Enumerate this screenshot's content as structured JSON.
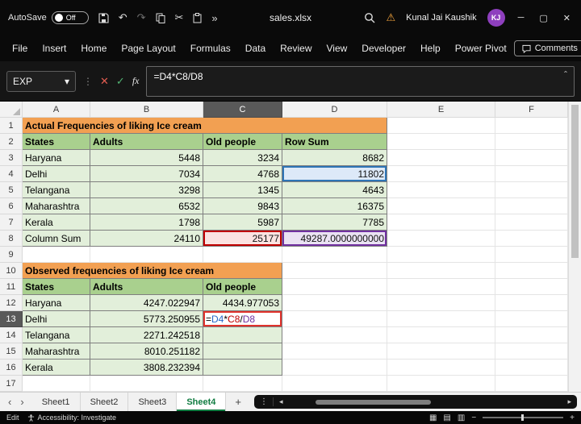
{
  "colors": {
    "excel_green": "#107C41",
    "title_orange": "#F2A052",
    "header_green": "#A9D08E",
    "cell_green": "#E2EFDA",
    "ref_blue": "#2E75B6",
    "ref_red": "#C00000",
    "ref_purple": "#7030A0",
    "avatar_purple": "#8E3FBE"
  },
  "icons": {
    "undo": "↶",
    "redo": "↷",
    "cut": "✂",
    "more_chevrons": "»",
    "minimize": "─",
    "maximize": "▢",
    "close": "✕",
    "name_box_dropdown": "▾",
    "separator_dots": "⋮",
    "cancel": "✕",
    "enter": "✓",
    "collapse_formula_bar": "ˆ",
    "warning": "⚠",
    "share_dropdown": "▾",
    "tab_scroll_left": "‹",
    "tab_scroll_right": "›",
    "overflow_dots": "⋮",
    "hscroll_left": "◂",
    "hscroll_right": "▸",
    "view_normal": "▦",
    "view_page": "▤",
    "view_break": "▥",
    "zoom_out": "−",
    "zoom_in": "+"
  },
  "titlebar": {
    "autosave_label": "AutoSave",
    "autosave_state": "Off",
    "filename": "sales.xlsx",
    "user_name": "Kunal Jai Kaushik",
    "user_initials": "KJ"
  },
  "menubar": {
    "items": [
      "File",
      "Insert",
      "Home",
      "Page Layout",
      "Formulas",
      "Data",
      "Review",
      "View",
      "Developer",
      "Help",
      "Power Pivot"
    ],
    "comments_label": "Comments"
  },
  "formula_bar": {
    "name_box_value": "EXP",
    "fx_label": "fx",
    "formula_text": "=D4*C8/D8"
  },
  "grid": {
    "col_headers": [
      "A",
      "B",
      "C",
      "D",
      "E",
      "F"
    ],
    "selected_col": "C",
    "selected_row": 13,
    "rows": [
      {
        "n": 1,
        "cells": [
          {
            "col": "A",
            "span": 4,
            "style": "title",
            "text": "Actual Frequencies of liking Ice cream"
          }
        ]
      },
      {
        "n": 2,
        "cells": [
          {
            "col": "A",
            "style": "header",
            "text": "States"
          },
          {
            "col": "B",
            "style": "header",
            "text": "Adults"
          },
          {
            "col": "C",
            "style": "header",
            "text": "Old people"
          },
          {
            "col": "D",
            "style": "header",
            "text": "Row Sum"
          }
        ]
      },
      {
        "n": 3,
        "cells": [
          {
            "col": "A",
            "style": "data",
            "text": "Haryana"
          },
          {
            "col": "B",
            "style": "data num",
            "text": "5448"
          },
          {
            "col": "C",
            "style": "data num",
            "text": "3234"
          },
          {
            "col": "D",
            "style": "data num",
            "text": "8682"
          }
        ]
      },
      {
        "n": 4,
        "cells": [
          {
            "col": "A",
            "style": "data",
            "text": "Delhi"
          },
          {
            "col": "B",
            "style": "data num",
            "text": "7034"
          },
          {
            "col": "C",
            "style": "data num",
            "text": "4768"
          },
          {
            "col": "D",
            "style": "refblue num",
            "text": "11802"
          }
        ]
      },
      {
        "n": 5,
        "cells": [
          {
            "col": "A",
            "style": "data",
            "text": "Telangana"
          },
          {
            "col": "B",
            "style": "data num",
            "text": "3298"
          },
          {
            "col": "C",
            "style": "data num",
            "text": "1345"
          },
          {
            "col": "D",
            "style": "data num",
            "text": "4643"
          }
        ]
      },
      {
        "n": 6,
        "cells": [
          {
            "col": "A",
            "style": "data",
            "text": "Maharashtra"
          },
          {
            "col": "B",
            "style": "data num",
            "text": "6532"
          },
          {
            "col": "C",
            "style": "data num",
            "text": "9843"
          },
          {
            "col": "D",
            "style": "data num",
            "text": "16375"
          }
        ]
      },
      {
        "n": 7,
        "cells": [
          {
            "col": "A",
            "style": "data",
            "text": "Kerala"
          },
          {
            "col": "B",
            "style": "data num",
            "text": "1798"
          },
          {
            "col": "C",
            "style": "data num",
            "text": "5987"
          },
          {
            "col": "D",
            "style": "data num",
            "text": "7785"
          }
        ]
      },
      {
        "n": 8,
        "cells": [
          {
            "col": "A",
            "style": "data",
            "text": "Column Sum"
          },
          {
            "col": "B",
            "style": "data num",
            "text": "24110"
          },
          {
            "col": "C",
            "style": "refred num",
            "text": "25177"
          },
          {
            "col": "D",
            "style": "refpurple num",
            "text": "49287.0000000000"
          }
        ]
      },
      {
        "n": 9,
        "cells": []
      },
      {
        "n": 10,
        "cells": [
          {
            "col": "A",
            "span": 3,
            "style": "title",
            "text": "Observed frequencies of liking Ice cream"
          }
        ]
      },
      {
        "n": 11,
        "cells": [
          {
            "col": "A",
            "style": "header",
            "text": "States"
          },
          {
            "col": "B",
            "style": "header",
            "text": "Adults"
          },
          {
            "col": "C",
            "style": "header",
            "text": "Old people"
          }
        ]
      },
      {
        "n": 12,
        "cells": [
          {
            "col": "A",
            "style": "data",
            "text": "Haryana"
          },
          {
            "col": "B",
            "style": "data num",
            "text": "4247.022947"
          },
          {
            "col": "C",
            "style": "data num",
            "text": "4434.977053"
          }
        ]
      },
      {
        "n": 13,
        "cells": [
          {
            "col": "A",
            "style": "data",
            "text": "Delhi"
          },
          {
            "col": "B",
            "style": "data num",
            "text": "5773.250955"
          },
          {
            "col": "C",
            "style": "edit",
            "parts": [
              {
                "t": "=",
                "c": "#000000"
              },
              {
                "t": "D4",
                "c": "#2667C9"
              },
              {
                "t": "*",
                "c": "#000000"
              },
              {
                "t": "C8",
                "c": "#C00000"
              },
              {
                "t": "/",
                "c": "#000000"
              },
              {
                "t": "D8",
                "c": "#7030A0"
              }
            ]
          }
        ]
      },
      {
        "n": 14,
        "cells": [
          {
            "col": "A",
            "style": "data",
            "text": "Telangana"
          },
          {
            "col": "B",
            "style": "data num",
            "text": "2271.242518"
          },
          {
            "col": "C",
            "style": "data",
            "text": ""
          }
        ]
      },
      {
        "n": 15,
        "cells": [
          {
            "col": "A",
            "style": "data",
            "text": "Maharashtra"
          },
          {
            "col": "B",
            "style": "data num",
            "text": "8010.251182"
          },
          {
            "col": "C",
            "style": "data",
            "text": ""
          }
        ]
      },
      {
        "n": 16,
        "cells": [
          {
            "col": "A",
            "style": "data",
            "text": "Kerala"
          },
          {
            "col": "B",
            "style": "data num",
            "text": "3808.232394"
          },
          {
            "col": "C",
            "style": "data",
            "text": ""
          }
        ]
      },
      {
        "n": 17,
        "cells": []
      }
    ]
  },
  "sheet_tabs": {
    "tabs": [
      "Sheet1",
      "Sheet2",
      "Sheet3",
      "Sheet4"
    ],
    "active_tab": "Sheet4",
    "add_label": "+"
  },
  "status_bar": {
    "mode": "Edit",
    "accessibility_label": "Accessibility: Investigate"
  }
}
